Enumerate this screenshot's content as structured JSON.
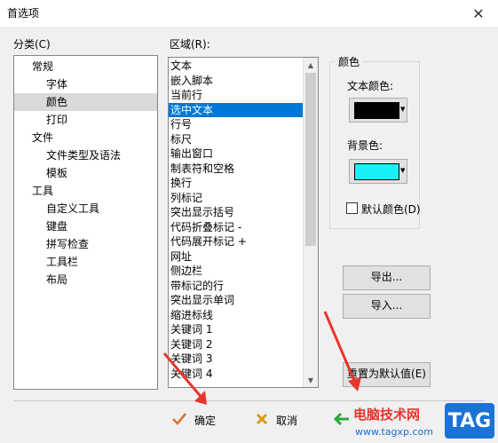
{
  "window": {
    "title": "首选项"
  },
  "category": {
    "label": "分类(C)",
    "items": [
      {
        "text": "常规",
        "level": 0
      },
      {
        "text": "字体",
        "level": 1
      },
      {
        "text": "颜色",
        "level": 1,
        "selected": true
      },
      {
        "text": "打印",
        "level": 1
      },
      {
        "text": "文件",
        "level": 0
      },
      {
        "text": "文件类型及语法",
        "level": 1
      },
      {
        "text": "模板",
        "level": 1
      },
      {
        "text": "工具",
        "level": 0
      },
      {
        "text": "自定义工具",
        "level": 1
      },
      {
        "text": "键盘",
        "level": 1
      },
      {
        "text": "拼写检查",
        "level": 1
      },
      {
        "text": "工具栏",
        "level": 1
      },
      {
        "text": "布局",
        "level": 1
      }
    ]
  },
  "area": {
    "label": "区域(R):",
    "items": [
      "文本",
      "嵌入脚本",
      "当前行",
      "选中文本",
      "行号",
      "标尺",
      "输出窗口",
      "制表符和空格",
      "换行",
      "列标记",
      "突出显示括号",
      "代码折叠标记 -",
      "代码展开标记 +",
      "网址",
      "侧边栏",
      "带标记的行",
      "突出显示单词",
      "缩进标线",
      "关键词 1",
      "关键词 2",
      "关键词 3",
      "关键词 4"
    ],
    "selected_index": 3
  },
  "color": {
    "group_label": "颜色",
    "text_color_label": "文本颜色:",
    "text_color": "#000000",
    "bg_color_label": "背景色:",
    "bg_color": "#18f0f7",
    "default_label": "默认颜色(D)"
  },
  "buttons": {
    "export": "导出...",
    "import": "导入...",
    "reset": "重置为默认值(E)",
    "ok": "确定",
    "cancel": "取消"
  },
  "watermark": {
    "site_name": "电脑技术网",
    "url": "www.tagxp.com",
    "tag": "TAG"
  },
  "colors": {
    "selection": "#0078d7",
    "annotation": "#e8352b"
  }
}
